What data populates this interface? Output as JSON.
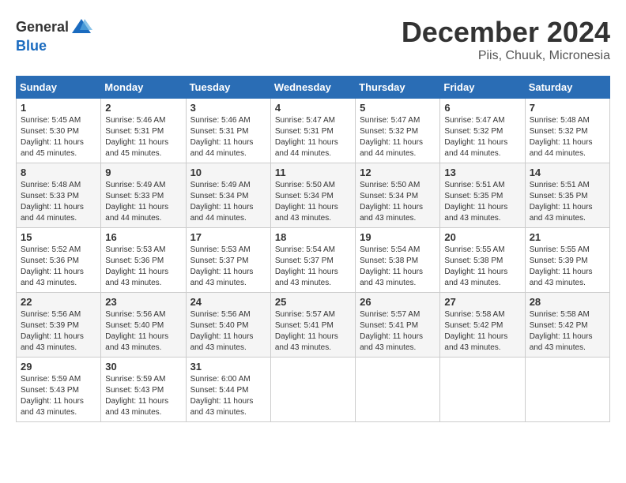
{
  "header": {
    "logo_general": "General",
    "logo_blue": "Blue",
    "month": "December 2024",
    "location": "Piis, Chuuk, Micronesia"
  },
  "weekdays": [
    "Sunday",
    "Monday",
    "Tuesday",
    "Wednesday",
    "Thursday",
    "Friday",
    "Saturday"
  ],
  "weeks": [
    [
      {
        "day": "1",
        "sunrise": "5:45 AM",
        "sunset": "5:30 PM",
        "daylight": "11 hours and 45 minutes."
      },
      {
        "day": "2",
        "sunrise": "5:46 AM",
        "sunset": "5:31 PM",
        "daylight": "11 hours and 45 minutes."
      },
      {
        "day": "3",
        "sunrise": "5:46 AM",
        "sunset": "5:31 PM",
        "daylight": "11 hours and 44 minutes."
      },
      {
        "day": "4",
        "sunrise": "5:47 AM",
        "sunset": "5:31 PM",
        "daylight": "11 hours and 44 minutes."
      },
      {
        "day": "5",
        "sunrise": "5:47 AM",
        "sunset": "5:32 PM",
        "daylight": "11 hours and 44 minutes."
      },
      {
        "day": "6",
        "sunrise": "5:47 AM",
        "sunset": "5:32 PM",
        "daylight": "11 hours and 44 minutes."
      },
      {
        "day": "7",
        "sunrise": "5:48 AM",
        "sunset": "5:32 PM",
        "daylight": "11 hours and 44 minutes."
      }
    ],
    [
      {
        "day": "8",
        "sunrise": "5:48 AM",
        "sunset": "5:33 PM",
        "daylight": "11 hours and 44 minutes."
      },
      {
        "day": "9",
        "sunrise": "5:49 AM",
        "sunset": "5:33 PM",
        "daylight": "11 hours and 44 minutes."
      },
      {
        "day": "10",
        "sunrise": "5:49 AM",
        "sunset": "5:34 PM",
        "daylight": "11 hours and 44 minutes."
      },
      {
        "day": "11",
        "sunrise": "5:50 AM",
        "sunset": "5:34 PM",
        "daylight": "11 hours and 43 minutes."
      },
      {
        "day": "12",
        "sunrise": "5:50 AM",
        "sunset": "5:34 PM",
        "daylight": "11 hours and 43 minutes."
      },
      {
        "day": "13",
        "sunrise": "5:51 AM",
        "sunset": "5:35 PM",
        "daylight": "11 hours and 43 minutes."
      },
      {
        "day": "14",
        "sunrise": "5:51 AM",
        "sunset": "5:35 PM",
        "daylight": "11 hours and 43 minutes."
      }
    ],
    [
      {
        "day": "15",
        "sunrise": "5:52 AM",
        "sunset": "5:36 PM",
        "daylight": "11 hours and 43 minutes."
      },
      {
        "day": "16",
        "sunrise": "5:53 AM",
        "sunset": "5:36 PM",
        "daylight": "11 hours and 43 minutes."
      },
      {
        "day": "17",
        "sunrise": "5:53 AM",
        "sunset": "5:37 PM",
        "daylight": "11 hours and 43 minutes."
      },
      {
        "day": "18",
        "sunrise": "5:54 AM",
        "sunset": "5:37 PM",
        "daylight": "11 hours and 43 minutes."
      },
      {
        "day": "19",
        "sunrise": "5:54 AM",
        "sunset": "5:38 PM",
        "daylight": "11 hours and 43 minutes."
      },
      {
        "day": "20",
        "sunrise": "5:55 AM",
        "sunset": "5:38 PM",
        "daylight": "11 hours and 43 minutes."
      },
      {
        "day": "21",
        "sunrise": "5:55 AM",
        "sunset": "5:39 PM",
        "daylight": "11 hours and 43 minutes."
      }
    ],
    [
      {
        "day": "22",
        "sunrise": "5:56 AM",
        "sunset": "5:39 PM",
        "daylight": "11 hours and 43 minutes."
      },
      {
        "day": "23",
        "sunrise": "5:56 AM",
        "sunset": "5:40 PM",
        "daylight": "11 hours and 43 minutes."
      },
      {
        "day": "24",
        "sunrise": "5:56 AM",
        "sunset": "5:40 PM",
        "daylight": "11 hours and 43 minutes."
      },
      {
        "day": "25",
        "sunrise": "5:57 AM",
        "sunset": "5:41 PM",
        "daylight": "11 hours and 43 minutes."
      },
      {
        "day": "26",
        "sunrise": "5:57 AM",
        "sunset": "5:41 PM",
        "daylight": "11 hours and 43 minutes."
      },
      {
        "day": "27",
        "sunrise": "5:58 AM",
        "sunset": "5:42 PM",
        "daylight": "11 hours and 43 minutes."
      },
      {
        "day": "28",
        "sunrise": "5:58 AM",
        "sunset": "5:42 PM",
        "daylight": "11 hours and 43 minutes."
      }
    ],
    [
      {
        "day": "29",
        "sunrise": "5:59 AM",
        "sunset": "5:43 PM",
        "daylight": "11 hours and 43 minutes."
      },
      {
        "day": "30",
        "sunrise": "5:59 AM",
        "sunset": "5:43 PM",
        "daylight": "11 hours and 43 minutes."
      },
      {
        "day": "31",
        "sunrise": "6:00 AM",
        "sunset": "5:44 PM",
        "daylight": "11 hours and 43 minutes."
      },
      null,
      null,
      null,
      null
    ]
  ]
}
